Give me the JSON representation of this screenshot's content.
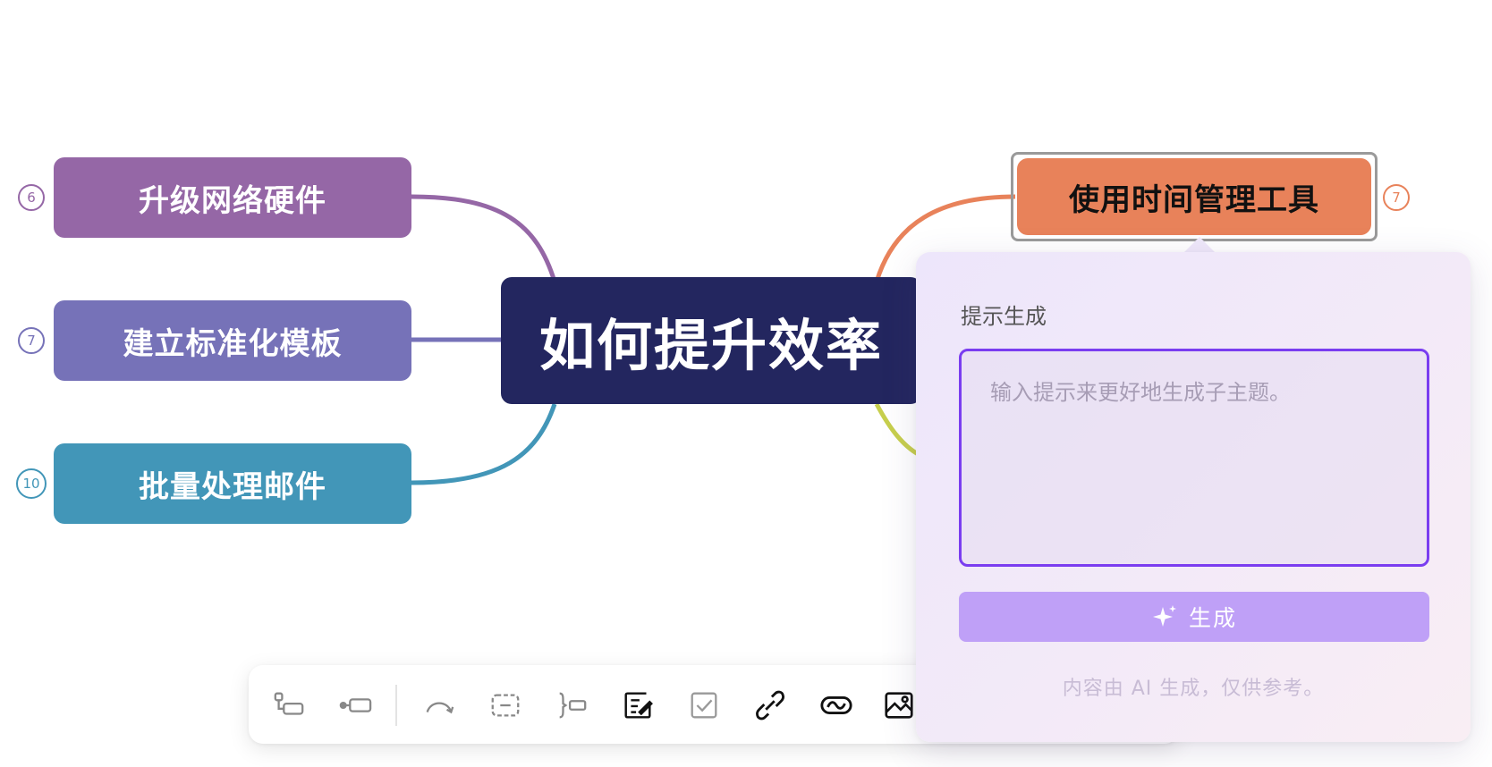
{
  "mindmap": {
    "root_label": "如何提升效率",
    "left_nodes": [
      {
        "label": "升级网络硬件",
        "count": "6",
        "color": "#9567a6"
      },
      {
        "label": "建立标准化模板",
        "count": "7",
        "color": "#7672b8"
      },
      {
        "label": "批量处理邮件",
        "count": "10",
        "color": "#4296b8"
      }
    ],
    "right_nodes": [
      {
        "label": "使用时间管理工具",
        "count": "7",
        "color": "#e8825a"
      }
    ],
    "hidden_branch_color": "#c7cf4d"
  },
  "toolbar": {
    "tools": [
      {
        "name": "insert-subtopic-icon"
      },
      {
        "name": "insert-sibling-topic-icon"
      },
      {
        "name": "relationship-curve-icon"
      },
      {
        "name": "boundary-icon"
      },
      {
        "name": "summary-icon"
      },
      {
        "name": "note-edit-icon"
      },
      {
        "name": "task-checkbox-icon"
      },
      {
        "name": "link-icon"
      },
      {
        "name": "topic-link-icon"
      },
      {
        "name": "image-icon"
      }
    ]
  },
  "ai_panel": {
    "title": "提示生成",
    "placeholder": "输入提示来更好地生成子主题。",
    "generate_label": "生成",
    "disclaimer": "内容由 AI 生成，仅供参考。",
    "accent_color": "#7a3df0",
    "button_color": "#bfa0f7"
  }
}
